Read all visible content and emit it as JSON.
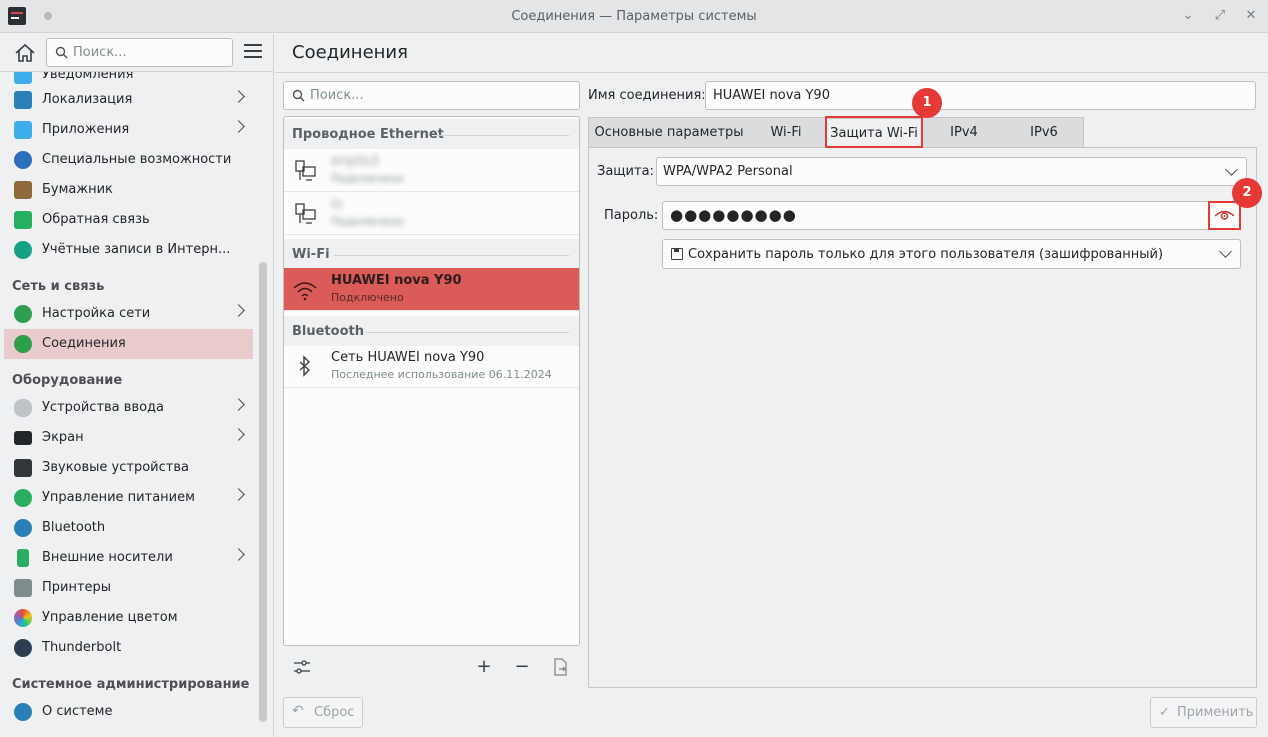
{
  "window": {
    "title": "Соединения — Параметры системы"
  },
  "sidebar": {
    "search_placeholder": "Поиск...",
    "partial_item": "Уведомления",
    "items": [
      {
        "label": "Локализация",
        "icon": "flag-icon",
        "chevron": true
      },
      {
        "label": "Приложения",
        "icon": "apps-icon",
        "chevron": true
      },
      {
        "label": "Специальные возможности",
        "icon": "accessibility-icon",
        "chevron": false
      },
      {
        "label": "Бумажник",
        "icon": "wallet-icon",
        "chevron": false
      },
      {
        "label": "Обратная связь",
        "icon": "feedback-icon",
        "chevron": false
      },
      {
        "label": "Учётные записи в Интерн...",
        "icon": "online-accounts-icon",
        "chevron": false
      }
    ],
    "sections": {
      "network": "Сеть и связь",
      "hardware": "Оборудование",
      "admin": "Системное администрирование"
    },
    "network_items": [
      {
        "label": "Настройка сети",
        "icon": "globe-icon",
        "chevron": true
      },
      {
        "label": "Соединения",
        "icon": "globe-icon",
        "chevron": false,
        "active": true
      }
    ],
    "hardware_items": [
      {
        "label": "Устройства ввода",
        "icon": "mouse-icon",
        "chevron": true
      },
      {
        "label": "Экран",
        "icon": "display-icon",
        "chevron": true
      },
      {
        "label": "Звуковые устройства",
        "icon": "speaker-icon",
        "chevron": false
      },
      {
        "label": "Управление питанием",
        "icon": "power-icon",
        "chevron": true
      },
      {
        "label": "Bluetooth",
        "icon": "bluetooth-icon",
        "chevron": false
      },
      {
        "label": "Внешние носители",
        "icon": "usb-icon",
        "chevron": true
      },
      {
        "label": "Принтеры",
        "icon": "printer-icon",
        "chevron": false
      },
      {
        "label": "Управление цветом",
        "icon": "color-icon",
        "chevron": false
      },
      {
        "label": "Thunderbolt",
        "icon": "thunderbolt-icon",
        "chevron": false
      }
    ],
    "admin_items": [
      {
        "label": "О системе",
        "icon": "info-icon",
        "chevron": false
      }
    ]
  },
  "header": {
    "title": "Соединения"
  },
  "connections": {
    "search_placeholder": "Поиск...",
    "groups": {
      "ethernet": "Проводное Ethernet",
      "wifi": "Wi-Fi",
      "bluetooth": "Bluetooth"
    },
    "ethernet_items": [
      {
        "name": "enp0s3",
        "sub": "Подключено"
      },
      {
        "name": "lo",
        "sub": "Подключено"
      }
    ],
    "wifi_items": [
      {
        "name": "HUAWEI nova Y90",
        "sub": "Подключено"
      }
    ],
    "bt_items": [
      {
        "name": "Сеть HUAWEI nova Y90",
        "sub": "Последнее использование 06.11.2024"
      }
    ],
    "tools": {
      "add": "+",
      "remove": "−"
    }
  },
  "editor": {
    "name_label": "Имя соединения:",
    "name_value": "HUAWEI nova Y90",
    "tabs": [
      "Основные параметры",
      "Wi-Fi",
      "Защита Wi-Fi",
      "IPv4",
      "IPv6"
    ],
    "active_tab": "Защита Wi-Fi",
    "security_label": "Защита:",
    "security_value": "WPA/WPA2 Personal",
    "password_label": "Пароль:",
    "password_value": "●●●●●●●●●",
    "store_option": "Сохранить пароль только для этого пользователя (зашифрованный)"
  },
  "annotations": {
    "badge1": "1",
    "badge2": "2",
    "color": "#e53935"
  },
  "buttons": {
    "reset": "Сброс",
    "apply": "Применить"
  },
  "colors": {
    "accent": "#da5b57",
    "active_sidebar": "#eacbcb"
  }
}
